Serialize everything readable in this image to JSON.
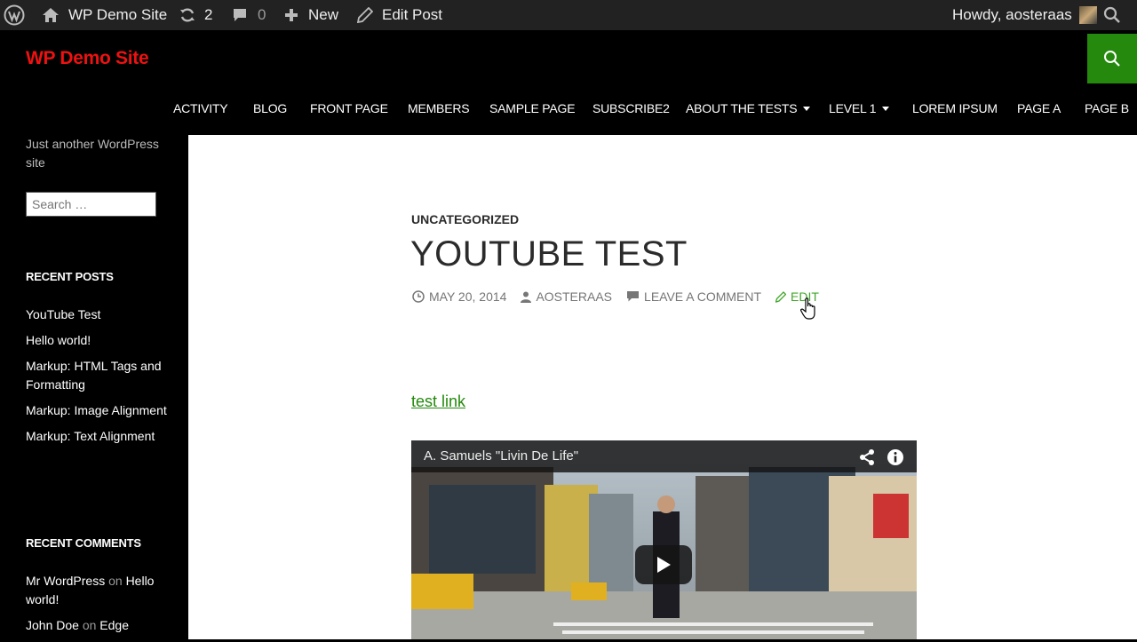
{
  "adminbar": {
    "site_name": "WP Demo Site",
    "updates_count": "2",
    "comments_count": "0",
    "new_label": "New",
    "edit_post_label": "Edit Post",
    "howdy": "Howdy, aosteraas"
  },
  "header": {
    "site_title": "WP Demo Site",
    "accent_color": "#24890d",
    "title_color": "#ee1111"
  },
  "nav": {
    "items": [
      {
        "label": "ACTIVITY"
      },
      {
        "label": "BLOG"
      },
      {
        "label": "FRONT PAGE"
      },
      {
        "label": "MEMBERS"
      },
      {
        "label": "SAMPLE PAGE"
      },
      {
        "label": "SUBSCRIBE2"
      },
      {
        "label": "ABOUT THE TESTS"
      },
      {
        "label": "LEVEL 1"
      },
      {
        "label": "LOREM IPSUM"
      },
      {
        "label": "PAGE A"
      },
      {
        "label": "PAGE B"
      }
    ]
  },
  "sidebar": {
    "description": "Just another WordPress site",
    "search_placeholder": "Search …",
    "recent_posts_title": "RECENT POSTS",
    "recent_posts": [
      "YouTube Test",
      "Hello world!",
      "Markup: HTML Tags and Formatting",
      "Markup: Image Alignment",
      "Markup: Text Alignment"
    ],
    "recent_comments_title": "RECENT COMMENTS",
    "recent_comments": [
      {
        "author": "Mr WordPress",
        "on": "on",
        "post": "Hello world!"
      },
      {
        "author": "John Doe",
        "on": "on",
        "post": "Edge"
      }
    ]
  },
  "post": {
    "category": "UNCATEGORIZED",
    "title": "YOUTUBE TEST",
    "date": "MAY 20, 2014",
    "author": "AOSTERAAS",
    "comment_link": "LEAVE A COMMENT",
    "edit_link": "EDIT",
    "body_link": " test link"
  },
  "video": {
    "title": "A. Samuels \"Livin De Life\""
  },
  "icons": [
    "wordpress-icon",
    "home-icon",
    "updates-icon",
    "comment-icon",
    "plus-icon",
    "pencil-icon",
    "search-icon",
    "clock-icon",
    "user-icon",
    "share-icon",
    "info-icon",
    "play-icon"
  ]
}
